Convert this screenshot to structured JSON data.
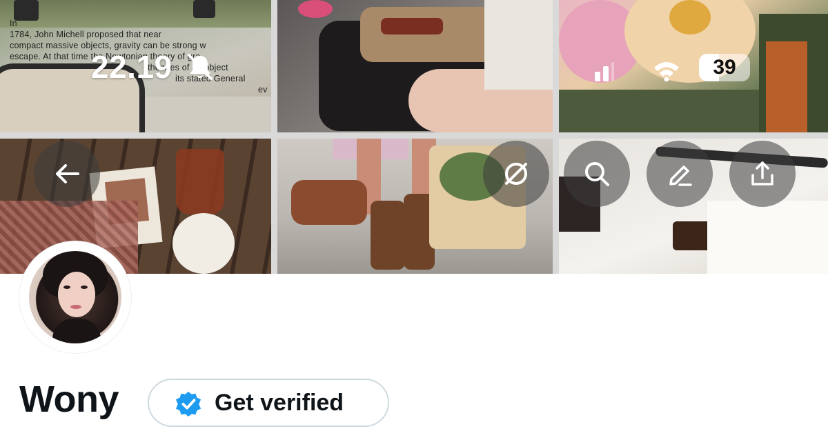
{
  "banner": {
    "overlay_text_lines": [
      "In",
      "1784, John Michell proposed that near",
      "compact massive objects, gravity can be strong w",
      "escape. At that time the Newtonian theory of gra",
      "theories of an object",
      "its stated General",
      "ev"
    ]
  },
  "status_bar": {
    "time": "22.19",
    "battery_level": "39",
    "battery_fraction": 0.39
  },
  "header_actions": {
    "back_label": "Back",
    "grok_label": "Grok",
    "search_label": "Search",
    "edit_label": "Edit",
    "share_label": "Share"
  },
  "profile": {
    "display_name": "Wony",
    "get_verified_label": "Get verified",
    "verified_badge_color": "#1d9bf0"
  }
}
